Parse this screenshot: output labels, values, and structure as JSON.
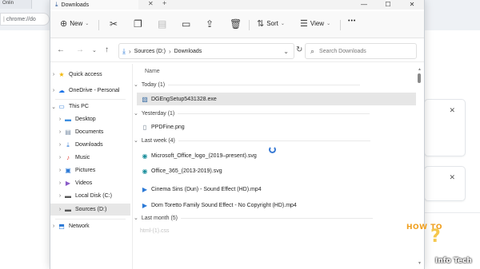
{
  "browser": {
    "tab_label": "Onlin",
    "address_text": "chrome://do"
  },
  "window": {
    "tab_title": "Downloads",
    "tab_close_glyph": "✕",
    "tab_add_glyph": "+",
    "caption": {
      "minimize": "—",
      "maximize": "☐",
      "close": "✕"
    }
  },
  "commandbar": {
    "new_label": "New",
    "sort_label": "Sort",
    "view_label": "View",
    "more_glyph": "•••"
  },
  "navigation": {
    "path": [
      "Sources (D:)",
      "Downloads"
    ],
    "search_placeholder": "Search Downloads"
  },
  "sidebar": {
    "items": [
      {
        "label": "Quick access",
        "icon": "star-icon"
      },
      {
        "label": "OneDrive - Personal",
        "icon": "cloud-icon"
      },
      {
        "label": "This PC",
        "icon": "pc-icon"
      },
      {
        "label": "Desktop",
        "icon": "desktop-icon"
      },
      {
        "label": "Documents",
        "icon": "documents-icon"
      },
      {
        "label": "Downloads",
        "icon": "download-icon"
      },
      {
        "label": "Music",
        "icon": "music-icon"
      },
      {
        "label": "Pictures",
        "icon": "pictures-icon"
      },
      {
        "label": "Videos",
        "icon": "videos-icon"
      },
      {
        "label": "Local Disk (C:)",
        "icon": "drive-icon"
      },
      {
        "label": "Sources (D:)",
        "icon": "drive-icon"
      },
      {
        "label": "Network",
        "icon": "network-icon"
      }
    ]
  },
  "filelist": {
    "column_name": "Name",
    "groups": [
      {
        "label": "Today (1)",
        "files": [
          {
            "name": "DGEngSetup5431328.exe",
            "selected": true
          }
        ]
      },
      {
        "label": "Yesterday (1)",
        "files": [
          {
            "name": "PPDFine.png"
          }
        ]
      },
      {
        "label": "Last week (4)",
        "files": [
          {
            "name": "Microsoft_Office_logo_(2019–present).svg"
          },
          {
            "name": "Office_365_(2013-2019).svg"
          },
          {
            "name": "Cinema Sins (Dun) - Sound Effect (HD).mp4"
          },
          {
            "name": "Dom Toretto Family Sound Effect - No Copyright (HD).mp4"
          }
        ]
      },
      {
        "label": "Last month (5)",
        "files": []
      }
    ],
    "faded_rows": [
      "html-(1).css"
    ]
  },
  "watermark": {
    "howto": "HOW TO",
    "brand": "Info Tech"
  },
  "colors": {
    "accent": "#2b79d6",
    "selection": "#e6e6e6",
    "watermark_orange": "#f0a020"
  }
}
